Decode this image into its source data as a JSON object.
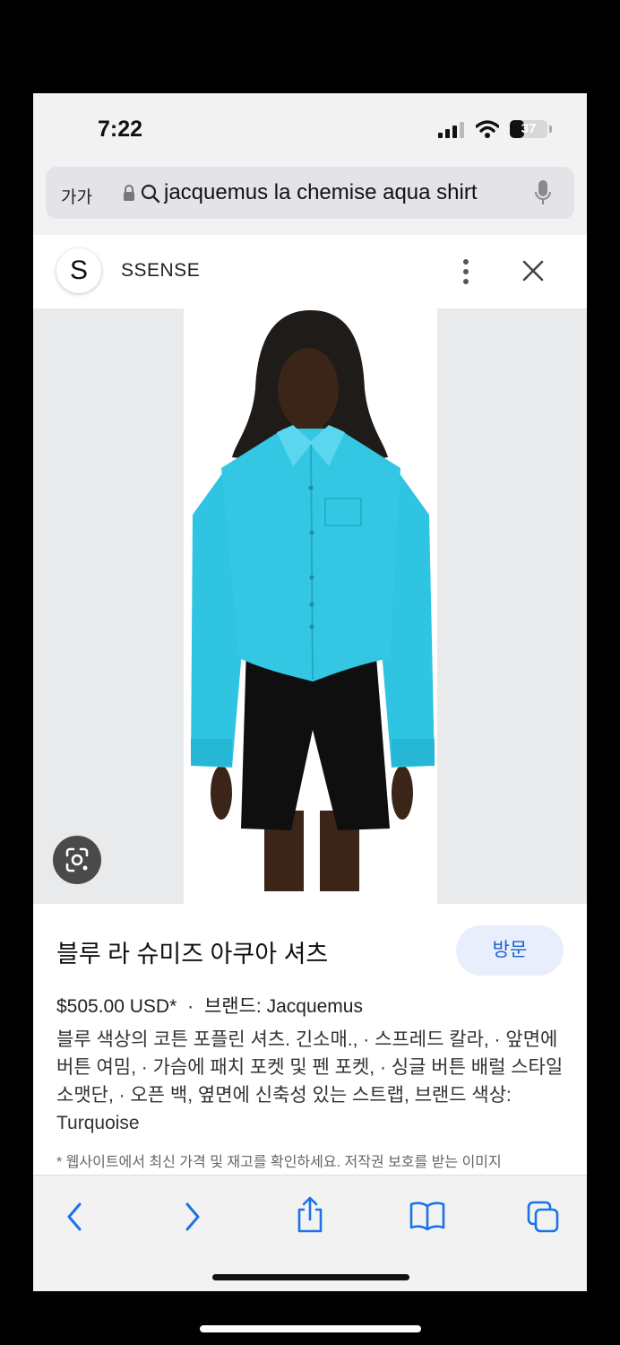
{
  "status_bar": {
    "time": "7:22",
    "battery": "37",
    "battery_level": 0.37
  },
  "url_bar": {
    "text_size_label": "가가",
    "query": "jacquemus la chemise aqua shirt"
  },
  "panel": {
    "site_initial": "S",
    "site_name": "SSENSE"
  },
  "product": {
    "title": "블루 라 슈미즈 아쿠아 셔츠",
    "visit_label": "방문",
    "price": "$505.00 USD*",
    "separator": "·",
    "brand": "브랜드: Jacquemus",
    "description": "블루 색상의 코튼 포플린 셔츠. 긴소매., · 스프레드 칼라, · 앞면에 버튼 여밈, · 가슴에 패치 포켓 및 펜 포켓, · 싱글 버튼 배럴 스타일 소맷단, · 오픈 백, 옆면에 신축성 있는 스트랩, 브랜드 색상: Turquoise",
    "note": "* 웹사이트에서 최신 가격 및 재고를 확인하세요. 저작권 보호를 받는 이미지"
  },
  "icons": {
    "lock": "lock-icon",
    "search": "search-icon",
    "mic": "microphone-icon",
    "menu": "more-vertical-icon",
    "close": "close-icon",
    "lens": "google-lens-icon",
    "back": "chevron-left-icon",
    "forward": "chevron-right-icon",
    "share": "share-icon",
    "bookmarks": "book-icon",
    "tabs": "tabs-icon"
  },
  "colors": {
    "accent": "#1a5fd0",
    "shirt": "#2ec3e0",
    "visit_bg": "#e8eefb"
  }
}
